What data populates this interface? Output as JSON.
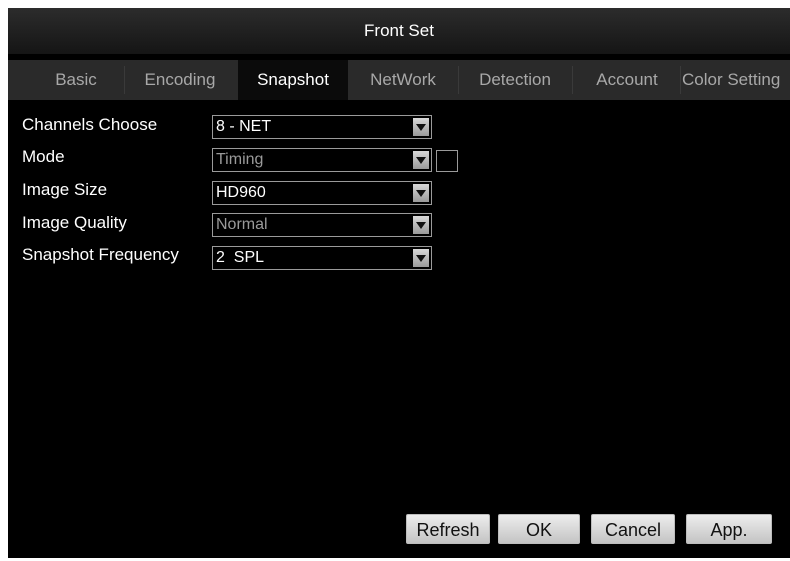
{
  "window": {
    "title": "Front Set"
  },
  "tabs": [
    {
      "label": "Basic"
    },
    {
      "label": "Encoding"
    },
    {
      "label": "Snapshot"
    },
    {
      "label": "NetWork"
    },
    {
      "label": "Detection"
    },
    {
      "label": "Account"
    },
    {
      "label": "Color Setting"
    }
  ],
  "active_tab": "Snapshot",
  "form": {
    "channels": {
      "label": "Channels Choose",
      "value": "8 - NET"
    },
    "mode": {
      "label": "Mode",
      "value": "Timing",
      "checkbox_checked": false
    },
    "image_size": {
      "label": "Image Size",
      "value": "HD960"
    },
    "image_quality": {
      "label": "Image Quality",
      "value": "Normal"
    },
    "frequency": {
      "label": "Snapshot Frequency",
      "value": "2  SPL"
    }
  },
  "buttons": {
    "refresh": "Refresh",
    "ok": "OK",
    "cancel": "Cancel",
    "apply": "App."
  },
  "colors": {
    "background": "#000000",
    "text": "#ffffff",
    "inactive_tab_text": "#a8a8a8",
    "button_face": "#dcdcdc"
  }
}
